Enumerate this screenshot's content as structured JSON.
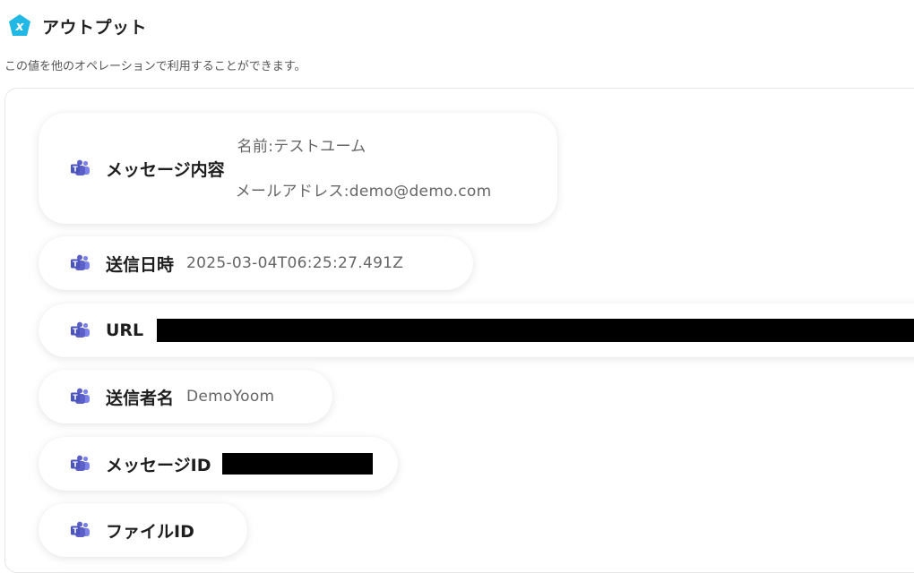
{
  "header": {
    "title": "アウトプット",
    "subtitle": "この値を他のオペレーションで利用することができます。"
  },
  "colors": {
    "brand": "#22B8E6",
    "teams": "#5B5FC7",
    "redaction": "#000000"
  },
  "outputs": [
    {
      "icon": "teams-icon",
      "label": "メッセージ内容",
      "value_lines": [
        "名前:テストユーム",
        "メールアドレス:demo@demo.com"
      ]
    },
    {
      "icon": "teams-icon",
      "label": "送信日時",
      "value": "2025-03-04T06:25:27.491Z"
    },
    {
      "icon": "teams-icon",
      "label": "URL",
      "value_redacted": true
    },
    {
      "icon": "teams-icon",
      "label": "送信者名",
      "value": "DemoYoom"
    },
    {
      "icon": "teams-icon",
      "label": "メッセージID",
      "value_redacted": true
    },
    {
      "icon": "teams-icon",
      "label": "ファイルID",
      "value": ""
    }
  ]
}
